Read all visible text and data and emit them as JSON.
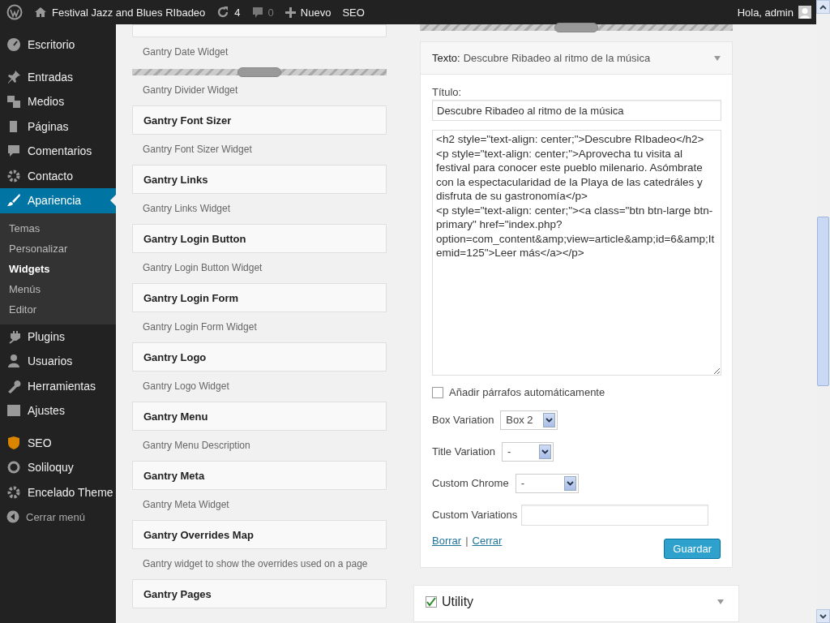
{
  "admin_bar": {
    "site": "Festival Jazz and Blues RIbadeo",
    "updates": "4",
    "comments": "0",
    "new": "Nuevo",
    "seo": "SEO",
    "greeting": "Hola, admin"
  },
  "sidebar": {
    "items": [
      {
        "label": "Escritorio",
        "selected": false
      },
      {
        "label": "Entradas",
        "selected": false
      },
      {
        "label": "Medios",
        "selected": false
      },
      {
        "label": "Páginas",
        "selected": false
      },
      {
        "label": "Comentarios",
        "selected": false
      },
      {
        "label": "Contacto",
        "selected": false
      },
      {
        "label": "Apariencia",
        "selected": true,
        "children": [
          {
            "label": "Temas",
            "selected": false
          },
          {
            "label": "Personalizar",
            "selected": false
          },
          {
            "label": "Widgets",
            "selected": true
          },
          {
            "label": "Menús",
            "selected": false
          },
          {
            "label": "Editor",
            "selected": false
          }
        ]
      },
      {
        "label": "Plugins",
        "selected": false
      },
      {
        "label": "Usuarios",
        "selected": false
      },
      {
        "label": "Herramientas",
        "selected": false
      },
      {
        "label": "Ajustes",
        "selected": false
      },
      {
        "label": "SEO",
        "selected": false
      },
      {
        "label": "Soliloquy",
        "selected": false
      },
      {
        "label": "Encelado Theme",
        "selected": false
      }
    ],
    "collapse": "Cerrar menú"
  },
  "available_widgets": [
    {
      "kind": "stub",
      "description": "Gantry Date Widget"
    },
    {
      "kind": "divider",
      "description": "Gantry Divider Widget"
    },
    {
      "kind": "card",
      "title": "Gantry Font Sizer",
      "description": "Gantry Font Sizer Widget"
    },
    {
      "kind": "card",
      "title": "Gantry Links",
      "description": "Gantry Links Widget"
    },
    {
      "kind": "card",
      "title": "Gantry Login Button",
      "description": "Gantry Login Button Widget"
    },
    {
      "kind": "card",
      "title": "Gantry Login Form",
      "description": "Gantry Login Form Widget"
    },
    {
      "kind": "card",
      "title": "Gantry Logo",
      "description": "Gantry Logo Widget"
    },
    {
      "kind": "card",
      "title": "Gantry Menu",
      "description": "Gantry Menu Description"
    },
    {
      "kind": "card",
      "title": "Gantry Meta",
      "description": "Gantry Meta Widget"
    },
    {
      "kind": "card",
      "title": "Gantry Overrides Map",
      "description": "Gantry widget to show the overrides used on a page"
    },
    {
      "kind": "card",
      "title": "Gantry Pages"
    }
  ],
  "widget": {
    "type": "Texto:",
    "name": "Descubre Ribadeo al ritmo de la música",
    "title_label": "Título:",
    "title_value": "Descubre Ribadeo al ritmo de la música",
    "content": "<h2 style=\"text-align: center;\">Descubre RIbadeo</h2>\n<p style=\"text-align: center;\">Aprovecha tu visita al festival para conocer este pueblo milenario. Asómbrate con la espectacularidad de la Playa de las catedráles y disfruta de su gastronomía</p>\n<p style=\"text-align: center;\"><a class=\"btn btn-large btn-primary\" href=\"index.php?option=com_content&amp;view=article&amp;id=6&amp;Itemid=125\">Leer más</a></p>",
    "autop": {
      "label": "Añadir párrafos automáticamente",
      "checked": false
    },
    "selects": [
      {
        "label": "Box Variation",
        "value": "Box 2"
      },
      {
        "label": "Title Variation",
        "value": "-"
      },
      {
        "label": "Custom Chrome",
        "value": "-"
      }
    ],
    "custom_variations_label": "Custom Variations",
    "delete": "Borrar",
    "separator": "|",
    "close": "Cerrar",
    "save": "Guardar"
  },
  "next_section": {
    "title": "Utility",
    "checked": true
  }
}
